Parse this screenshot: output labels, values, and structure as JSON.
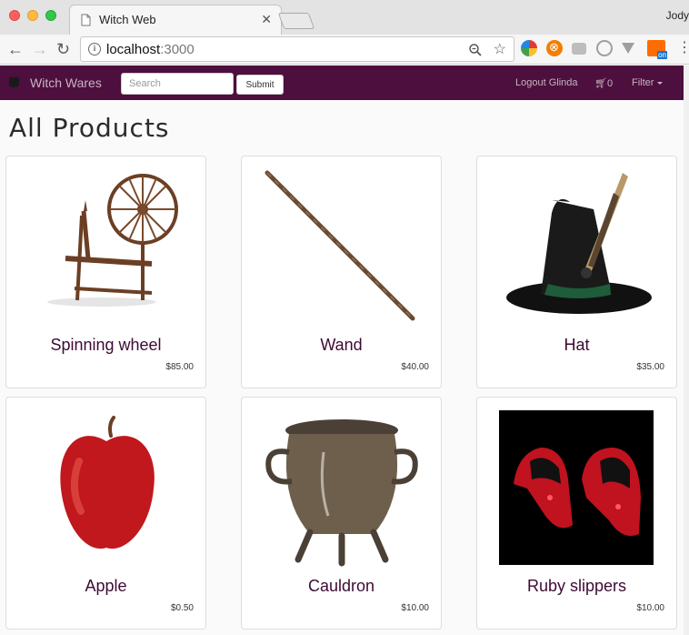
{
  "browser": {
    "tab_title": "Witch Web",
    "profile_name": "Jody",
    "url_host": "localhost",
    "url_port": ":3000"
  },
  "navbar": {
    "brand": "Witch Wares",
    "search_placeholder": "Search",
    "submit_label": "Submit",
    "logout_label": "Logout Glinda",
    "cart_count": "0",
    "filter_label": "Filter"
  },
  "page": {
    "title": "All Products"
  },
  "products": [
    {
      "name": "Spinning wheel",
      "price": "$85.00",
      "icon": "spinning-wheel"
    },
    {
      "name": "Wand",
      "price": "$40.00",
      "icon": "wand"
    },
    {
      "name": "Hat",
      "price": "$35.00",
      "icon": "witch-hat"
    },
    {
      "name": "Apple",
      "price": "$0.50",
      "icon": "apple"
    },
    {
      "name": "Cauldron",
      "price": "$10.00",
      "icon": "cauldron"
    },
    {
      "name": "Ruby slippers",
      "price": "$10.00",
      "icon": "ruby-slippers"
    }
  ],
  "colors": {
    "navbar": "#4d0f3e",
    "product_name": "#3d0a33"
  }
}
